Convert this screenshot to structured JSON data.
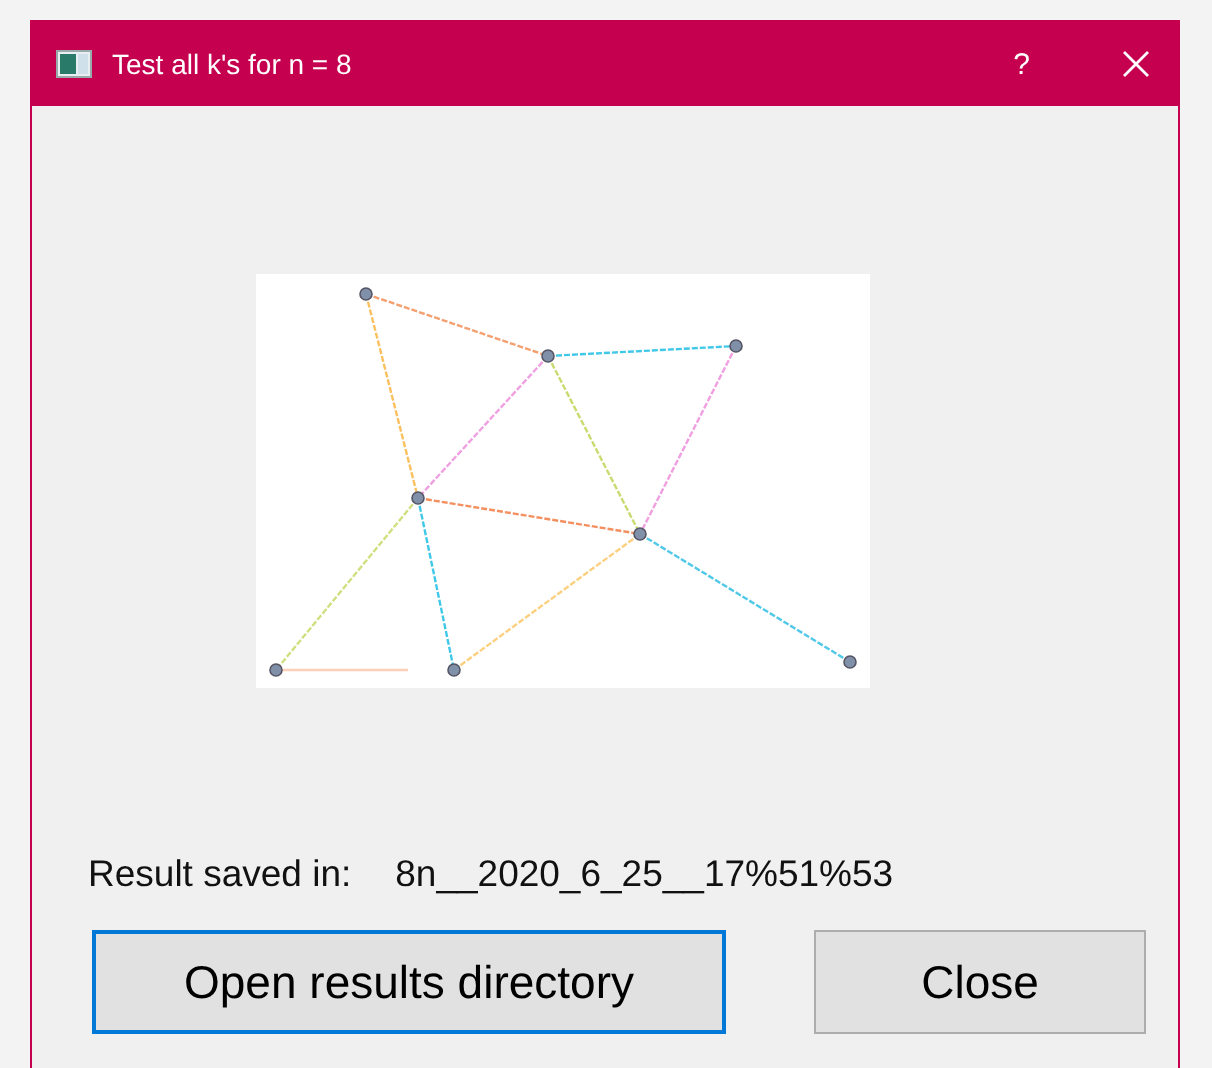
{
  "window": {
    "title": "Test all k's for n = 8",
    "help": "?"
  },
  "result": {
    "label": "Result saved in:",
    "value": "8n__2020_6_25__17%51%53"
  },
  "buttons": [
    {
      "label": "Open results directory",
      "focused": true
    },
    {
      "label": "Close",
      "focused": false
    }
  ]
}
